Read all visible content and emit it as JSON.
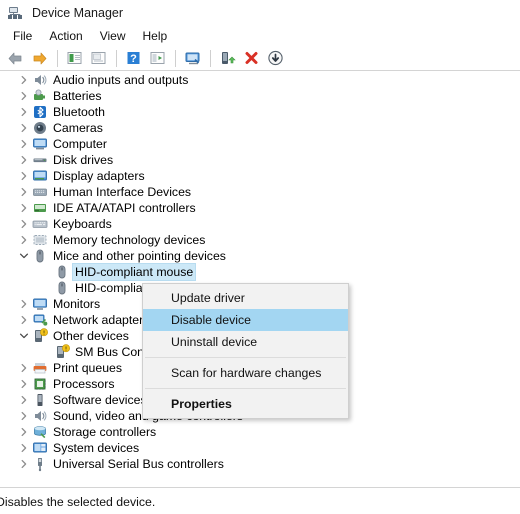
{
  "window": {
    "title": "Device Manager",
    "icon": "device-manager-icon"
  },
  "menubar": {
    "items": [
      {
        "label": "File"
      },
      {
        "label": "Action"
      },
      {
        "label": "View"
      },
      {
        "label": "Help"
      }
    ]
  },
  "toolbar": {
    "buttons": [
      {
        "icon": "back-arrow-icon",
        "enabled": true
      },
      {
        "icon": "forward-arrow-icon",
        "enabled": true
      },
      {
        "icon": "show-hidden-devices-icon",
        "enabled": false
      },
      {
        "icon": "properties-icon",
        "enabled": false
      },
      {
        "icon": "help-icon",
        "enabled": true
      },
      {
        "icon": "console-icon",
        "enabled": true
      },
      {
        "icon": "scan-hardware-changes-icon",
        "enabled": true
      },
      {
        "icon": "update-driver-icon",
        "enabled": true
      },
      {
        "icon": "uninstall-device-icon",
        "enabled": true
      },
      {
        "icon": "disable-device-icon",
        "enabled": true
      }
    ]
  },
  "tree": {
    "items": [
      {
        "label": "Audio inputs and outputs",
        "icon": "speaker-icon",
        "expander": "collapsed",
        "level": 0
      },
      {
        "label": "Batteries",
        "icon": "battery-icon",
        "expander": "collapsed",
        "level": 0
      },
      {
        "label": "Bluetooth",
        "icon": "bluetooth-icon",
        "expander": "collapsed",
        "level": 0
      },
      {
        "label": "Cameras",
        "icon": "camera-icon",
        "expander": "collapsed",
        "level": 0
      },
      {
        "label": "Computer",
        "icon": "computer-icon",
        "expander": "collapsed",
        "level": 0
      },
      {
        "label": "Disk drives",
        "icon": "disk-drive-icon",
        "expander": "collapsed",
        "level": 0
      },
      {
        "label": "Display adapters",
        "icon": "display-adapter-icon",
        "expander": "collapsed",
        "level": 0
      },
      {
        "label": "Human Interface Devices",
        "icon": "hid-icon",
        "expander": "collapsed",
        "level": 0
      },
      {
        "label": "IDE ATA/ATAPI controllers",
        "icon": "ide-controller-icon",
        "expander": "collapsed",
        "level": 0
      },
      {
        "label": "Keyboards",
        "icon": "keyboard-icon",
        "expander": "collapsed",
        "level": 0
      },
      {
        "label": "Memory technology devices",
        "icon": "memory-icon",
        "expander": "collapsed",
        "level": 0
      },
      {
        "label": "Mice and other pointing devices",
        "icon": "mouse-icon",
        "expander": "expanded",
        "level": 0
      },
      {
        "label": "HID-compliant mouse",
        "icon": "mouse-icon",
        "expander": "none",
        "level": 1,
        "selected": true
      },
      {
        "label": "HID-compliant mouse",
        "icon": "mouse-icon",
        "expander": "none",
        "level": 1
      },
      {
        "label": "Monitors",
        "icon": "monitor-icon",
        "expander": "collapsed",
        "level": 0
      },
      {
        "label": "Network adapters",
        "icon": "network-adapter-icon",
        "expander": "collapsed",
        "level": 0
      },
      {
        "label": "Other devices",
        "icon": "other-device-warning-icon",
        "expander": "expanded",
        "level": 0
      },
      {
        "label": "SM Bus Controller",
        "icon": "other-device-warning-icon",
        "expander": "none",
        "level": 1
      },
      {
        "label": "Print queues",
        "icon": "print-queue-icon",
        "expander": "collapsed",
        "level": 0
      },
      {
        "label": "Processors",
        "icon": "processor-icon",
        "expander": "collapsed",
        "level": 0
      },
      {
        "label": "Software devices",
        "icon": "software-device-icon",
        "expander": "collapsed",
        "level": 0
      },
      {
        "label": "Sound, video and game controllers",
        "icon": "speaker-icon",
        "expander": "collapsed",
        "level": 0
      },
      {
        "label": "Storage controllers",
        "icon": "storage-controller-icon",
        "expander": "collapsed",
        "level": 0
      },
      {
        "label": "System devices",
        "icon": "system-device-icon",
        "expander": "collapsed",
        "level": 0
      },
      {
        "label": "Universal Serial Bus controllers",
        "icon": "usb-icon",
        "expander": "collapsed",
        "level": 0
      }
    ]
  },
  "context_menu": {
    "items": [
      {
        "label": "Update driver",
        "type": "item"
      },
      {
        "label": "Disable device",
        "type": "item",
        "highlighted": true
      },
      {
        "label": "Uninstall device",
        "type": "item"
      },
      {
        "type": "separator"
      },
      {
        "label": "Scan for hardware changes",
        "type": "item"
      },
      {
        "type": "separator"
      },
      {
        "label": "Properties",
        "type": "item",
        "bold": true
      }
    ]
  },
  "statusbar": {
    "text": "Disables the selected device."
  },
  "colors": {
    "selection_blue": "#cce8f7",
    "menu_highlight": "#a3d6f2",
    "menu_background": "#f2f2f2",
    "border": "#d4d4d4"
  }
}
